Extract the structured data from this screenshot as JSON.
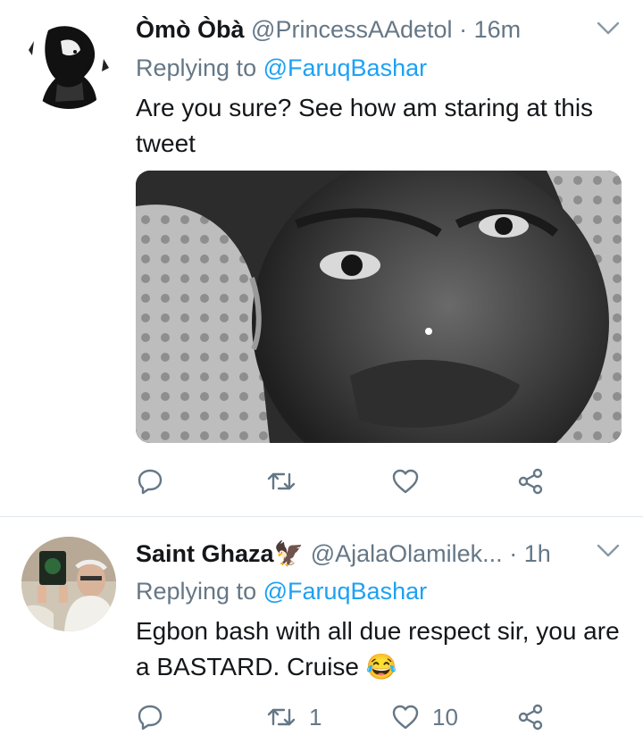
{
  "tweets": [
    {
      "display_name": "Òmò Òbà",
      "handle": "@PrincessAAdetol",
      "separator": "·",
      "time": "16m",
      "replying_prefix": "Replying to",
      "replying_to": "@FaruqBashar",
      "text": "Are you sure? See how am staring at this tweet",
      "media_alt": "grayscale photo",
      "actions": {
        "reply_count": "",
        "retweet_count": "",
        "like_count": ""
      }
    },
    {
      "display_name": "Saint Ghaza",
      "name_emoji": "🦅",
      "handle": "@AjalaOlamilek...",
      "separator": "·",
      "time": "1h",
      "replying_prefix": "Replying to",
      "replying_to": "@FaruqBashar",
      "text": "Egbon bash with all due respect sir, you are a BASTARD. Cruise",
      "text_emoji": "😂",
      "actions": {
        "reply_count": "",
        "retweet_count": "1",
        "like_count": "10"
      }
    }
  ],
  "colors": {
    "secondary_text": "#657786",
    "link": "#1da1f2",
    "divider": "#e1e8ed",
    "primary_text": "#14171a"
  },
  "icons": [
    "reply-icon",
    "retweet-icon",
    "like-icon",
    "share-icon",
    "chevron-down-icon"
  ]
}
